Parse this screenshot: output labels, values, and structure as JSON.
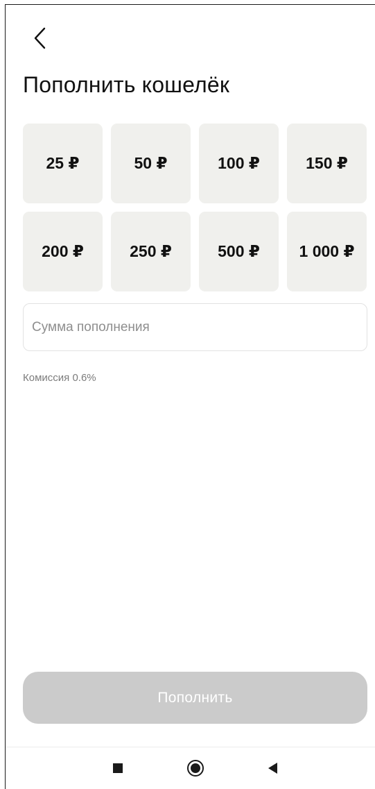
{
  "header": {
    "back_icon": "chevron-left-icon",
    "title": "Пополнить кошелёк"
  },
  "amounts": [
    {
      "label": "25 ₽"
    },
    {
      "label": "50 ₽"
    },
    {
      "label": "100 ₽"
    },
    {
      "label": "150 ₽"
    },
    {
      "label": "200 ₽"
    },
    {
      "label": "250 ₽"
    },
    {
      "label": "500 ₽"
    },
    {
      "label": "1 000 ₽"
    }
  ],
  "amount_input": {
    "value": "",
    "placeholder": "Сумма пополнения"
  },
  "commission": "Комиссия 0.6%",
  "submit": {
    "label": "Пополнить",
    "state": "disabled"
  },
  "system_nav": {
    "recents_icon": "square-icon",
    "home_icon": "circle-home-icon",
    "back_icon": "triangle-back-icon"
  },
  "colors": {
    "tile_bg": "#f0f0ed",
    "button_disabled_bg": "#cbcbcb",
    "button_text": "#ffffff",
    "muted_text": "#7c7c7c"
  }
}
